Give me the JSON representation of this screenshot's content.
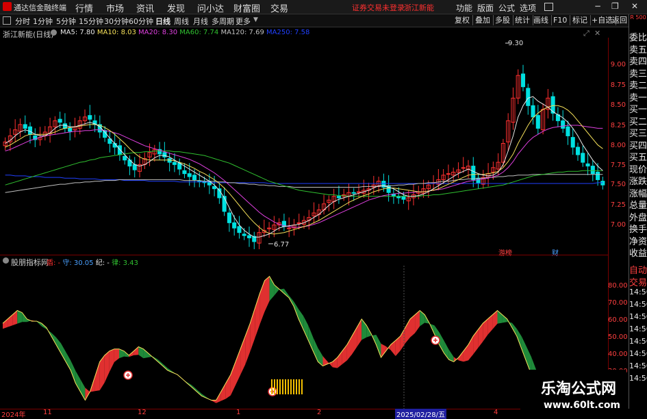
{
  "app": {
    "name": "通达信金融终端",
    "menu": [
      "行情",
      "市场",
      "资讯",
      "发现",
      "问小达",
      "财富圈",
      "交易"
    ],
    "notice": "证券交易未登录",
    "stock_title": "浙江新能",
    "right_menu": [
      "功能",
      "版面",
      "公式",
      "选项"
    ],
    "window_buttons": [
      "−",
      "❐",
      "✕"
    ]
  },
  "periods": [
    "分时",
    "1分钟",
    "5分钟",
    "15分钟",
    "30分钟",
    "60分钟",
    "日线",
    "周线",
    "月线",
    "多周期",
    "更多"
  ],
  "active_period": "日线",
  "tools": [
    "复权",
    "叠加",
    "多股",
    "统计",
    "画线",
    "F10",
    "标记",
    "+自选",
    "返回"
  ],
  "main_chart": {
    "title": "浙江新能(日线)",
    "ma_legend": [
      {
        "label": "MA5: 7.80",
        "color": "#e8e8e8"
      },
      {
        "label": "MA10: 8.03",
        "color": "#f5e05a"
      },
      {
        "label": "MA20: 8.30",
        "color": "#e040e0"
      },
      {
        "label": "MA60: 7.74",
        "color": "#30c030"
      },
      {
        "label": "MA120: 7.69",
        "color": "#c0c0c0"
      },
      {
        "label": "MA250: 7.58",
        "color": "#2040ff"
      }
    ],
    "high_marker": "9.30",
    "low_marker": "6.77",
    "event_labels": [
      "游榜",
      "财"
    ]
  },
  "price_axis": [
    "9.00",
    "8.75",
    "8.50",
    "8.25",
    "8.00",
    "7.75",
    "7.50",
    "7.25",
    "7.00"
  ],
  "indicator": {
    "name": "股朋指标网",
    "legend": [
      {
        "label": "盾: -",
        "color": "#ff3030"
      },
      {
        "label": "守: 30.05",
        "color": "#4aa0ff"
      },
      {
        "label": "纪: -",
        "color": "#e8e8e8"
      },
      {
        "label": "律: 3.43",
        "color": "#30c030"
      }
    ],
    "axis": [
      "80.00",
      "70.00",
      "60.00",
      "50.00",
      "40.00",
      "30.00"
    ]
  },
  "right_panel": {
    "header": "R 500",
    "top_labels": [
      "委比",
      "卖五",
      "卖四",
      "卖三",
      "卖二",
      "卖一",
      "买一",
      "买二",
      "买三",
      "买四",
      "买五",
      "现价",
      "涨跌",
      "涨幅",
      "总量",
      "外盘",
      "换手",
      "净资",
      "收益"
    ],
    "bottom_labels": [
      "自动",
      "交易",
      "14:56",
      "14:56",
      "14:56",
      "14:56",
      "14:56",
      "14:56",
      "14:56",
      "14:56"
    ]
  },
  "date_axis": {
    "labels": [
      "2024年",
      "11",
      "12",
      "1",
      "2",
      "4"
    ],
    "cursor_label": "2025/02/28/五"
  },
  "watermark": {
    "title": "乐淘公式网",
    "url": "www.60lt.com"
  },
  "chart_data": {
    "type": "candlestick",
    "price_range": [
      6.6,
      9.5
    ],
    "indicator_range": [
      18,
      85
    ],
    "closes": [
      8.12,
      8.2,
      8.28,
      8.35,
      8.3,
      8.22,
      8.15,
      8.18,
      8.25,
      8.32,
      8.4,
      8.38,
      8.3,
      8.26,
      8.32,
      8.4,
      8.45,
      8.42,
      8.35,
      8.25,
      8.18,
      8.1,
      8.05,
      7.95,
      7.88,
      7.8,
      7.75,
      7.82,
      7.9,
      7.98,
      8.02,
      7.96,
      7.92,
      7.85,
      7.82,
      7.76,
      7.7,
      7.66,
      7.62,
      7.6,
      7.58,
      7.55,
      7.5,
      7.38,
      7.2,
      7.05,
      6.98,
      6.92,
      6.88,
      6.85,
      6.8,
      6.92,
      6.95,
      6.98,
      7.02,
      7.05,
      7.0,
      6.98,
      7.02,
      7.05,
      7.08,
      7.12,
      7.18,
      7.22,
      7.3,
      7.35,
      7.4,
      7.38,
      7.42,
      7.45,
      7.44,
      7.46,
      7.48,
      7.5,
      7.55,
      7.6,
      7.52,
      7.45,
      7.4,
      7.38,
      7.36,
      7.38,
      7.42,
      7.46,
      7.5,
      7.55,
      7.58,
      7.62,
      7.68,
      7.7,
      7.72,
      7.75,
      7.78,
      7.8,
      7.62,
      7.58,
      7.65,
      7.7,
      7.78,
      7.85,
      8.1,
      8.4,
      8.7,
      9.0,
      8.85,
      8.6,
      8.45,
      8.3,
      8.55,
      8.7,
      8.5,
      8.4,
      8.3,
      8.2,
      8.05,
      7.95,
      7.85,
      7.8,
      7.7,
      7.62,
      7.55
    ],
    "ma5": [
      8.1,
      8.14,
      8.2,
      8.25,
      8.28,
      8.26,
      8.22,
      8.2,
      8.2,
      8.24,
      8.3,
      8.34,
      8.34,
      8.32,
      8.32,
      8.34,
      8.36,
      8.38,
      8.36,
      8.32,
      8.25,
      8.17,
      8.1,
      8.02,
      7.95,
      7.88,
      7.82,
      7.8,
      7.82,
      7.86,
      7.91,
      7.94,
      7.94,
      7.92,
      7.88,
      7.84,
      7.8,
      7.76,
      7.72,
      7.68,
      7.64,
      7.6,
      7.55,
      7.48,
      7.38,
      7.25,
      7.12,
      7.02,
      6.95,
      6.9,
      6.86,
      6.86,
      6.88,
      6.9,
      6.94,
      6.98,
      7.0,
      7.01,
      7.02,
      7.03,
      7.05,
      7.08,
      7.12,
      7.16,
      7.22,
      7.28,
      7.33,
      7.36,
      7.38,
      7.4,
      7.42,
      7.44,
      7.46,
      7.48,
      7.51,
      7.54,
      7.54,
      7.52,
      7.5,
      7.46,
      7.42,
      7.4,
      7.4,
      7.41,
      7.43,
      7.46,
      7.5,
      7.54,
      7.58,
      7.62,
      7.66,
      7.7,
      7.73,
      7.76,
      7.73,
      7.7,
      7.68,
      7.67,
      7.68,
      7.72,
      7.82,
      8.0,
      8.2,
      8.45,
      8.6,
      8.7,
      8.72,
      8.66,
      8.62,
      8.58,
      8.52,
      8.48,
      8.44,
      8.38,
      8.3,
      8.2,
      8.08,
      7.98,
      7.88,
      7.8,
      7.74
    ],
    "ma10": [
      8.05,
      8.08,
      8.12,
      8.16,
      8.2,
      8.22,
      8.22,
      8.22,
      8.22,
      8.23,
      8.25,
      8.28,
      8.3,
      8.31,
      8.32,
      8.33,
      8.34,
      8.35,
      8.35,
      8.34,
      8.31,
      8.27,
      8.22,
      8.16,
      8.1,
      8.03,
      7.97,
      7.92,
      7.89,
      7.88,
      7.88,
      7.88,
      7.88,
      7.88,
      7.87,
      7.85,
      7.83,
      7.8,
      7.77,
      7.73,
      7.7,
      7.66,
      7.62,
      7.57,
      7.51,
      7.44,
      7.36,
      7.28,
      7.2,
      7.12,
      7.05,
      6.99,
      6.94,
      6.91,
      6.9,
      6.91,
      6.92,
      6.94,
      6.96,
      6.98,
      7.0,
      7.02,
      7.05,
      7.08,
      7.12,
      7.16,
      7.2,
      7.24,
      7.28,
      7.32,
      7.35,
      7.38,
      7.41,
      7.43,
      7.46,
      7.48,
      7.5,
      7.51,
      7.51,
      7.5,
      7.49,
      7.48,
      7.47,
      7.46,
      7.46,
      7.47,
      7.48,
      7.5,
      7.53,
      7.56,
      7.59,
      7.62,
      7.65,
      7.68,
      7.69,
      7.69,
      7.69,
      7.7,
      7.71,
      7.73,
      7.78,
      7.86,
      7.96,
      8.1,
      8.22,
      8.34,
      8.44,
      8.5,
      8.55,
      8.58,
      8.6,
      8.6,
      8.58,
      8.54,
      8.48,
      8.4,
      8.32,
      8.24,
      8.16,
      8.08,
      8.03
    ],
    "ma20": [
      8.0,
      8.02,
      8.05,
      8.08,
      8.11,
      8.14,
      8.16,
      8.18,
      8.2,
      8.21,
      8.22,
      8.23,
      8.24,
      8.25,
      8.26,
      8.26,
      8.27,
      8.27,
      8.28,
      8.28,
      8.27,
      8.26,
      8.24,
      8.22,
      8.19,
      8.16,
      8.13,
      8.1,
      8.07,
      8.05,
      8.03,
      8.01,
      7.99,
      7.97,
      7.95,
      7.93,
      7.91,
      7.89,
      7.86,
      7.83,
      7.79,
      7.75,
      7.71,
      7.66,
      7.61,
      7.55,
      7.49,
      7.43,
      7.37,
      7.31,
      7.25,
      7.19,
      7.14,
      7.1,
      7.06,
      7.03,
      7.01,
      7.0,
      6.99,
      6.99,
      7.0,
      7.01,
      7.03,
      7.05,
      7.08,
      7.11,
      7.14,
      7.17,
      7.2,
      7.23,
      7.26,
      7.29,
      7.32,
      7.35,
      7.37,
      7.39,
      7.41,
      7.42,
      7.43,
      7.44,
      7.44,
      7.45,
      7.45,
      7.46,
      7.46,
      7.47,
      7.48,
      7.49,
      7.5,
      7.52,
      7.54,
      7.56,
      7.58,
      7.6,
      7.61,
      7.62,
      7.63,
      7.64,
      7.66,
      7.68,
      7.72,
      7.78,
      7.86,
      7.96,
      8.04,
      8.12,
      8.18,
      8.22,
      8.26,
      8.29,
      8.31,
      8.32,
      8.33,
      8.34,
      8.34,
      8.34,
      8.33,
      8.32,
      8.31,
      8.3,
      8.3
    ],
    "ma60": [
      7.55,
      7.57,
      7.59,
      7.61,
      7.63,
      7.65,
      7.67,
      7.69,
      7.71,
      7.73,
      7.75,
      7.77,
      7.79,
      7.81,
      7.83,
      7.85,
      7.86,
      7.88,
      7.89,
      7.91,
      7.92,
      7.93,
      7.94,
      7.95,
      7.96,
      7.97,
      7.98,
      7.98,
      7.99,
      7.99,
      8.0,
      8.0,
      8.0,
      8.0,
      7.99,
      7.99,
      7.98,
      7.97,
      7.96,
      7.95,
      7.94,
      7.92,
      7.9,
      7.88,
      7.86,
      7.84,
      7.81,
      7.78,
      7.75,
      7.72,
      7.69,
      7.66,
      7.63,
      7.6,
      7.58,
      7.56,
      7.54,
      7.52,
      7.5,
      7.48,
      7.47,
      7.46,
      7.45,
      7.44,
      7.43,
      7.42,
      7.42,
      7.41,
      7.41,
      7.4,
      7.4,
      7.4,
      7.4,
      7.4,
      7.4,
      7.4,
      7.4,
      7.4,
      7.4,
      7.4,
      7.4,
      7.4,
      7.4,
      7.4,
      7.41,
      7.41,
      7.42,
      7.42,
      7.43,
      7.44,
      7.45,
      7.46,
      7.47,
      7.48,
      7.49,
      7.5,
      7.51,
      7.52,
      7.53,
      7.54,
      7.55,
      7.57,
      7.59,
      7.61,
      7.63,
      7.65,
      7.67,
      7.68,
      7.69,
      7.7,
      7.71,
      7.72,
      7.72,
      7.73,
      7.73,
      7.73,
      7.74,
      7.74,
      7.74,
      7.74,
      7.74
    ],
    "ma120": [
      7.45,
      7.46,
      7.47,
      7.48,
      7.49,
      7.5,
      7.51,
      7.52,
      7.53,
      7.54,
      7.55,
      7.56,
      7.56,
      7.57,
      7.58,
      7.58,
      7.59,
      7.59,
      7.6,
      7.6,
      7.61,
      7.61,
      7.61,
      7.62,
      7.62,
      7.62,
      7.62,
      7.62,
      7.62,
      7.62,
      7.62,
      7.62,
      7.62,
      7.62,
      7.62,
      7.62,
      7.61,
      7.61,
      7.61,
      7.61,
      7.6,
      7.6,
      7.6,
      7.59,
      7.59,
      7.58,
      7.58,
      7.57,
      7.57,
      7.56,
      7.56,
      7.55,
      7.55,
      7.54,
      7.54,
      7.53,
      7.53,
      7.53,
      7.52,
      7.52,
      7.52,
      7.52,
      7.52,
      7.52,
      7.52,
      7.52,
      7.52,
      7.52,
      7.52,
      7.52,
      7.52,
      7.52,
      7.53,
      7.53,
      7.53,
      7.53,
      7.54,
      7.54,
      7.54,
      7.55,
      7.55,
      7.56,
      7.56,
      7.57,
      7.57,
      7.58,
      7.58,
      7.59,
      7.6,
      7.6,
      7.61,
      7.62,
      7.62,
      7.63,
      7.63,
      7.64,
      7.64,
      7.65,
      7.65,
      7.66,
      7.66,
      7.67,
      7.67,
      7.68,
      7.68,
      7.68,
      7.69,
      7.69,
      7.69,
      7.69,
      7.69,
      7.69,
      7.69,
      7.69,
      7.69,
      7.69,
      7.69,
      7.69,
      7.69,
      7.69,
      7.69
    ],
    "ma250": [
      7.68,
      7.68,
      7.67,
      7.67,
      7.67,
      7.66,
      7.66,
      7.66,
      7.65,
      7.65,
      7.65,
      7.65,
      7.64,
      7.64,
      7.64,
      7.63,
      7.63,
      7.63,
      7.63,
      7.62,
      7.62,
      7.62,
      7.62,
      7.62,
      7.61,
      7.61,
      7.61,
      7.61,
      7.61,
      7.6,
      7.6,
      7.6,
      7.6,
      7.6,
      7.6,
      7.59,
      7.59,
      7.59,
      7.59,
      7.59,
      7.59,
      7.59,
      7.58,
      7.58,
      7.58,
      7.58,
      7.58,
      7.58,
      7.58,
      7.58,
      7.58,
      7.58,
      7.58,
      7.57,
      7.57,
      7.57,
      7.57,
      7.57,
      7.57,
      7.57,
      7.57,
      7.57,
      7.57,
      7.57,
      7.57,
      7.57,
      7.57,
      7.57,
      7.57,
      7.57,
      7.57,
      7.57,
      7.57,
      7.57,
      7.57,
      7.57,
      7.57,
      7.57,
      7.57,
      7.57,
      7.57,
      7.57,
      7.57,
      7.57,
      7.57,
      7.57,
      7.57,
      7.57,
      7.57,
      7.57,
      7.57,
      7.57,
      7.57,
      7.57,
      7.57,
      7.57,
      7.57,
      7.57,
      7.57,
      7.57,
      7.57,
      7.57,
      7.57,
      7.57,
      7.57,
      7.57,
      7.57,
      7.57,
      7.57,
      7.57,
      7.57,
      7.57,
      7.57,
      7.57,
      7.57,
      7.57,
      7.57,
      7.57,
      7.57,
      7.58,
      7.58
    ],
    "indicator_values": [
      58,
      60,
      62,
      64,
      63,
      60,
      59,
      59,
      58,
      56,
      52,
      48,
      44,
      40,
      36,
      30,
      26,
      22,
      26,
      33,
      40,
      43,
      45,
      46,
      46,
      45,
      43,
      45,
      47,
      46,
      44,
      42,
      40,
      38,
      36,
      35,
      34,
      32,
      30,
      28,
      26,
      24,
      23,
      22,
      22,
      26,
      30,
      34,
      40,
      46,
      52,
      58,
      65,
      72,
      78,
      80,
      76,
      74,
      72,
      70,
      66,
      60,
      55,
      50,
      45,
      40,
      38,
      39,
      40,
      42,
      45,
      48,
      52,
      56,
      60,
      57,
      53,
      48,
      42,
      45,
      48,
      50,
      52,
      56,
      60,
      62,
      64,
      62,
      58,
      53,
      48,
      44,
      41,
      40,
      42,
      45,
      48,
      52,
      55,
      58,
      60,
      62,
      64,
      62,
      60,
      56,
      52,
      46,
      40,
      34,
      28,
      24,
      22,
      20,
      19,
      18,
      18,
      19,
      20,
      21,
      22
    ]
  }
}
